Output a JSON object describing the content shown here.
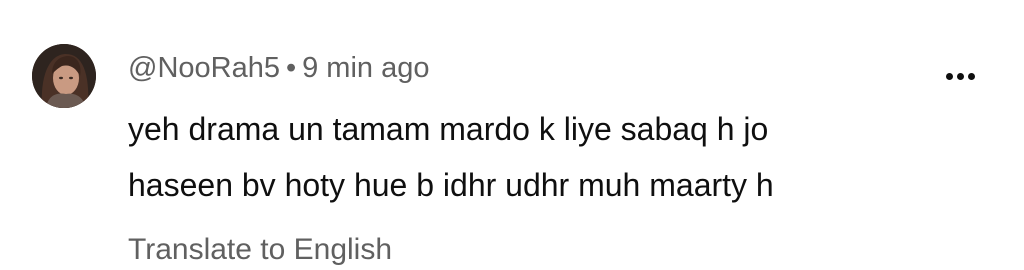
{
  "comment": {
    "author": "@NooRah5",
    "separator": "•",
    "timestamp": "9 min ago",
    "text_line_1": "yeh drama un tamam mardo k liye sabaq h jo",
    "text_line_2": "haseen bv hoty hue b idhr udhr muh maarty h",
    "translate_label": "Translate to English",
    "more_icon": "more-vertical-icon"
  }
}
